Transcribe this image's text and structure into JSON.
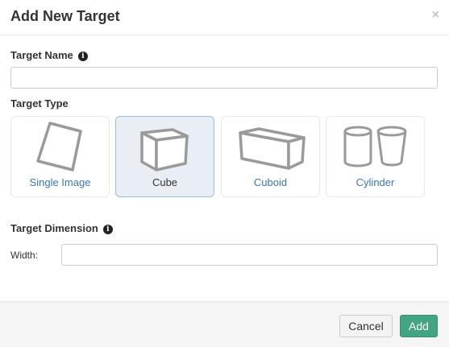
{
  "dialog": {
    "title": "Add New Target",
    "close_glyph": "×"
  },
  "target_name": {
    "label": "Target Name",
    "info_glyph": "i",
    "value": "",
    "placeholder": ""
  },
  "target_type": {
    "label": "Target Type",
    "selected": "Cube",
    "options": [
      {
        "label": "Single Image",
        "icon": "single-image-icon"
      },
      {
        "label": "Cube",
        "icon": "cube-icon"
      },
      {
        "label": "Cuboid",
        "icon": "cuboid-icon"
      },
      {
        "label": "Cylinder",
        "icon": "cylinder-icon"
      }
    ]
  },
  "target_dimension": {
    "label": "Target Dimension",
    "info_glyph": "i",
    "width_label": "Width:",
    "width_value": ""
  },
  "footer": {
    "cancel_label": "Cancel",
    "add_label": "Add"
  },
  "colors": {
    "accent_green": "#41a583",
    "link_blue": "#3a76b5",
    "selected_bg": "#e9eef5"
  }
}
